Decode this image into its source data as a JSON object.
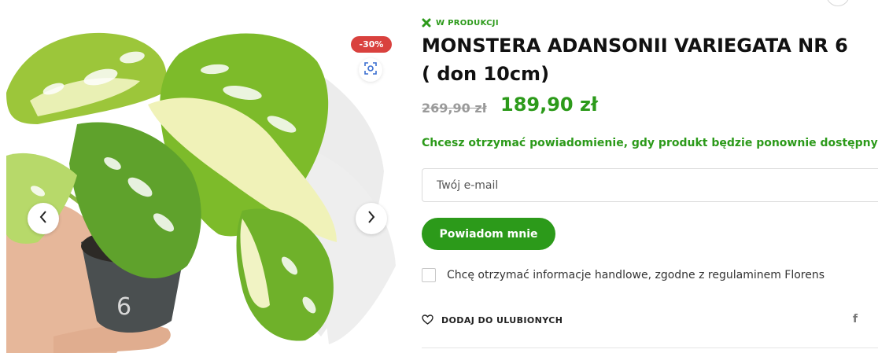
{
  "gallery": {
    "discount_badge": "-30%",
    "pot_number": "6",
    "icons": {
      "zoom": "zoom-scan-icon",
      "prev": "chevron-left-icon",
      "next": "chevron-right-icon"
    }
  },
  "product": {
    "status": "W PRODUKCJI",
    "status_icon": "x-icon",
    "title": "MONSTERA ADANSONII VARIEGATA NR 6 ( don 10cm)",
    "price_old": "269,90 zł",
    "price_new": "189,90 zł"
  },
  "notify": {
    "question": "Chcesz otrzymać powiadomienie, gdy produkt będzie ponownie dostępny?",
    "email_placeholder": "Twój e-mail",
    "button_label": "Powiadom mnie",
    "consent_label": "Chcę otrzymać informacje handlowe, zgodne z regulaminem Florens"
  },
  "actions": {
    "favorite_label": "DODAJ DO ULUBIONYCH",
    "favorite_icon": "heart-icon",
    "share_facebook": "f"
  },
  "colors": {
    "brand_green": "#2c9a1a",
    "discount_red": "#d9413e"
  }
}
